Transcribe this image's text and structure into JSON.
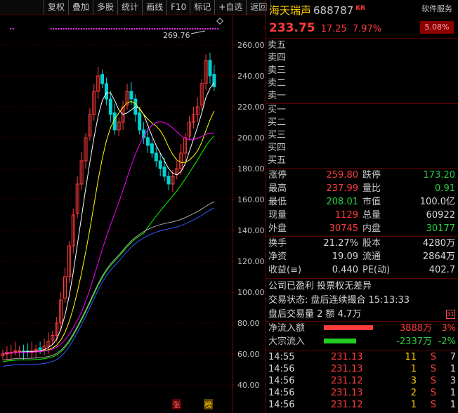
{
  "toolbar": [
    "复权",
    "叠加",
    "多股",
    "统计",
    "画线",
    "F10",
    "标记",
    "+自选",
    "返回"
  ],
  "chart": {
    "y_labels": [
      "260.00",
      "240.00",
      "220.00",
      "200.00",
      "180.00",
      "160.00",
      "140.00",
      "120.00",
      "100.00",
      "80.00",
      "60.00",
      "40.00"
    ],
    "high_label": "269.76",
    "badge_zhang": "张",
    "badge_bang": "榜",
    "colors": {
      "up": "#ff3b3b",
      "down": "#00d2d2",
      "ma5": "#ffffff",
      "ma10": "#ffff00",
      "ma20": "#ff00ff",
      "ma30": "#00ff00",
      "ma60": "#aaaaaa",
      "ma120": "#3355ff"
    }
  },
  "header": {
    "name": "海天瑞声",
    "code": "688787",
    "tag": "KR",
    "service": "软件服务",
    "service_pct": "5.08%",
    "price": "233.75",
    "change": "17.25",
    "change_pct": "7.97%"
  },
  "orderbook": {
    "sell": [
      "卖五",
      "卖四",
      "卖三",
      "卖二",
      "卖一"
    ],
    "buy": [
      "买一",
      "买二",
      "买三",
      "买四",
      "买五"
    ]
  },
  "quotes": [
    {
      "l1": "涨停",
      "v1": "259.80",
      "c1": "red",
      "l2": "跌停",
      "v2": "173.20",
      "c2": "green"
    },
    {
      "l1": "最高",
      "v1": "237.99",
      "c1": "red",
      "l2": "量比",
      "v2": "0.91",
      "c2": "green"
    },
    {
      "l1": "最低",
      "v1": "208.01",
      "c1": "green",
      "l2": "市值",
      "v2": "100.0亿",
      "c2": "white"
    },
    {
      "l1": "现量",
      "v1": "1129",
      "c1": "red",
      "l2": "总量",
      "v2": "60922",
      "c2": "white"
    },
    {
      "l1": "外盘",
      "v1": "30745",
      "c1": "red",
      "l2": "内盘",
      "v2": "30177",
      "c2": "green"
    }
  ],
  "quotes2": [
    {
      "l1": "换手",
      "v1": "21.27%",
      "l2": "股本",
      "v2": "4280万"
    },
    {
      "l1": "净资",
      "v1": "19.09",
      "l2": "流通",
      "v2": "2864万"
    },
    {
      "l1": "收益(≡)",
      "v1": "0.440",
      "l2": "PE(动)",
      "v2": "402.7"
    }
  ],
  "info": {
    "profit": "公司已盈利 投票权无差异",
    "status": "交易状态: 盘后连续撮合 15:13:33",
    "after": "盘后交易量 2 额 4.7万"
  },
  "flows": [
    {
      "label": "净流入额",
      "value": "3888万",
      "pct": "3%",
      "color": "#ff3b3b",
      "frac": 0.5,
      "dir": "up"
    },
    {
      "label": "大宗流入",
      "value": "-2337万",
      "pct": "-2%",
      "color": "#22cc22",
      "frac": 0.33,
      "dir": "down"
    }
  ],
  "ticks": [
    {
      "time": "14:55",
      "price": "231.13",
      "vol": "11",
      "side": "S",
      "cnt": "7"
    },
    {
      "time": "14:56",
      "price": "231.13",
      "vol": "1",
      "side": "S",
      "cnt": "1"
    },
    {
      "time": "14:56",
      "price": "231.12",
      "vol": "3",
      "side": "S",
      "cnt": "3"
    },
    {
      "time": "14:56",
      "price": "231.13",
      "vol": "2",
      "side": "S",
      "cnt": "1"
    },
    {
      "time": "14:56",
      "price": "231.12",
      "vol": "1",
      "side": "S",
      "cnt": "1"
    }
  ]
}
